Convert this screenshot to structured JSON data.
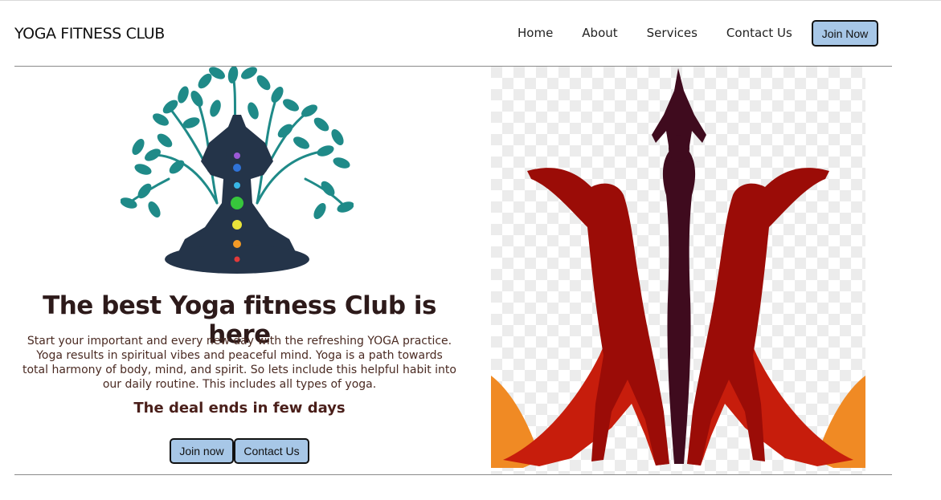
{
  "header": {
    "brand": "YOGA FITNESS CLUB",
    "nav": [
      "Home",
      "About",
      "Services",
      "Contact Us"
    ],
    "join_label": "Join Now"
  },
  "hero": {
    "headline": "The best Yoga fitness Club is here",
    "blurb": "Start your important and every new day with the refreshing YOGA practice. Yoga results in spiritual vibes and peaceful mind. Yoga is a path towards total harmony of body, mind, and spirit. So lets include this helpful habit into our daily routine. This includes all types of yoga.",
    "deal": "The deal ends in few days",
    "join_label": "Join now",
    "contact_label": "Contact Us"
  },
  "colors": {
    "button_bg": "#a7c7e7",
    "tree_teal": "#1f8a88",
    "figure_navy": "#243449",
    "chakra": [
      "#9b59d6",
      "#2f73d8",
      "#38b6e6",
      "#37c63c",
      "#e9e43a",
      "#f39a26",
      "#e23a3a"
    ],
    "figure_dark": "#3f0b1e",
    "figure_red": "#b81f10",
    "figure_orange": "#f08a24"
  },
  "icons": {
    "tree_figure": "meditation-tree-illustration",
    "yoga_group": "yoga-poses-illustration"
  }
}
